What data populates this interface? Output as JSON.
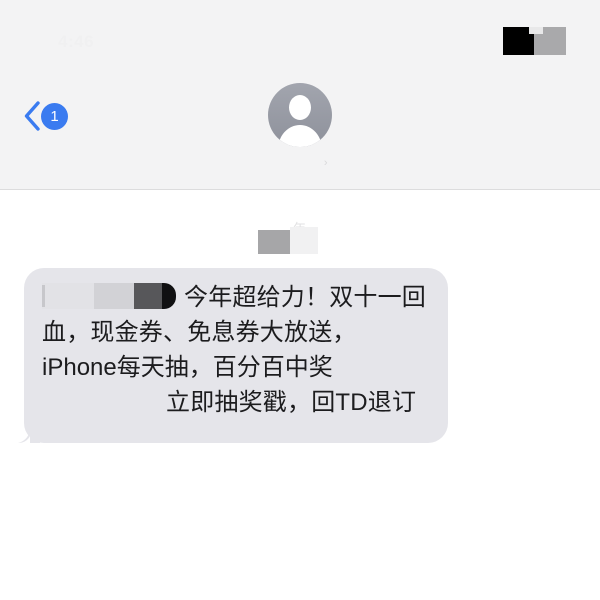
{
  "app": {
    "name": "Messages",
    "platform": "iOS"
  },
  "status_bar": {
    "time": "4:46",
    "redaction_note": "redacted",
    "icons": [
      "signal-icon",
      "wifi-icon",
      "battery-icon"
    ]
  },
  "nav_bar": {
    "back_label": "",
    "back_badge_count": "1",
    "avatar_icon": "person-avatar-icon",
    "contact_name": "",
    "contact_name_redacted": "       ",
    "contact_detail_chevron": "›"
  },
  "conversation": {
    "timestamp": {
      "text": "年",
      "redacted": true
    },
    "messages": [
      {
        "id": "msg-1",
        "direction": "incoming",
        "sender_tag_redacted": true,
        "bubble_color": "#e5e5ea",
        "text_color": "#1c1c1e",
        "line1": "今年超给力！双十",
        "line2": "一回血，现金券、免息券大放",
        "line3": "送， iPhone每天抽，百分百中奖",
        "link_redacted": "",
        "line4": "立即抽奖戳，回TD退",
        "line5": "订",
        "full_text": "【███】今年超给力！双十一回血，现金券、免息券大放送， iPhone每天抽，百分百中奖 立即抽奖戳，回TD退订"
      }
    ]
  },
  "colors": {
    "nav_background": "#f3f3f4",
    "body_background": "#ffffff",
    "bubble_incoming": "#e5e5ea",
    "accent_blue": "#3a7bf0",
    "avatar_gray": "#8e919b",
    "divider": "#dcdcdd"
  }
}
